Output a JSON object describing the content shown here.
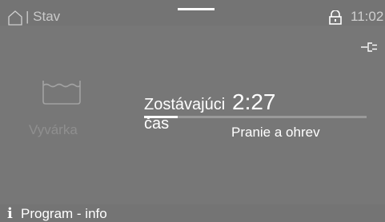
{
  "header": {
    "breadcrumb": "| Stav",
    "clock": "11:02",
    "icons": [
      "home-icon",
      "lock-icon",
      "plug-icon"
    ]
  },
  "program": {
    "name": "Vyvárka",
    "icon": "tub-icon"
  },
  "status": {
    "remaining_label": "Zostávajúci čas",
    "remaining_time": "2:27",
    "phase": "Pranie a ohrev",
    "progress": 0.15
  },
  "footer": {
    "info_label": "Program - info",
    "icon": "info-icon"
  },
  "colors": {
    "background": "#777777",
    "bar": "#747474",
    "text": "#ffffff",
    "muted": "#8f8f8f"
  }
}
